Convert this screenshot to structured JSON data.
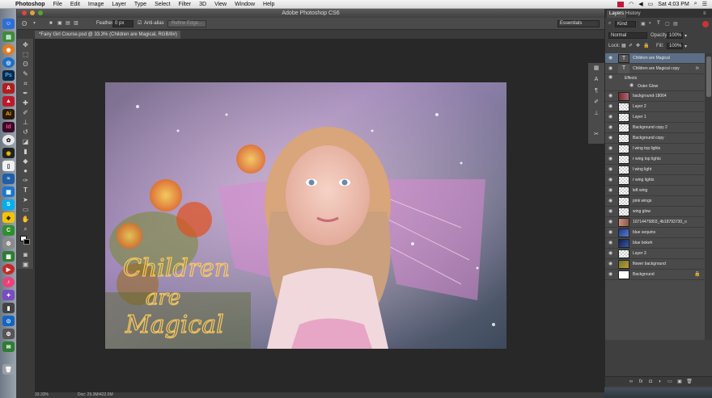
{
  "menubar": {
    "app_name": "Photoshop",
    "items": [
      "File",
      "Edit",
      "Image",
      "Layer",
      "Type",
      "Select",
      "Filter",
      "3D",
      "View",
      "Window",
      "Help"
    ],
    "clock": "Sat 4:03 PM"
  },
  "window": {
    "title": "Adobe Photoshop CS6"
  },
  "options_bar": {
    "feather_label": "Feather:",
    "feather_value": "0 px",
    "antialias_label": "Anti-alias",
    "refine_edge_label": "Refine Edge...",
    "workspace": "Essentials"
  },
  "document": {
    "tab_title": "*Fairy Girl Course.psd @ 33.3% (Children are Magical, RGB/8#)",
    "artwork_text": "Children are Magical",
    "zoom": "33.33%",
    "doc_size": "Doc: 29.3M/422.0M"
  },
  "panel": {
    "tabs": [
      "Layers",
      "History"
    ],
    "kind_label": "Kind",
    "blend_mode": "Normal",
    "opacity_label": "Opacity:",
    "opacity_value": "100%",
    "lock_label": "Lock:",
    "fill_label": "Fill:",
    "fill_value": "100%"
  },
  "layers": [
    {
      "name": "Children are Magical",
      "type": "text",
      "selected": true
    },
    {
      "name": "Children are Magical copy",
      "type": "text",
      "fx": true
    },
    {
      "name": "Effects",
      "type": "effect-group"
    },
    {
      "name": "Outer Glow",
      "type": "effect"
    },
    {
      "name": "background-18064",
      "type": "image"
    },
    {
      "name": "Layer 2",
      "type": "checker"
    },
    {
      "name": "Layer 1",
      "type": "checker"
    },
    {
      "name": "Background copy 2",
      "type": "checker"
    },
    {
      "name": "Background copy",
      "type": "checker"
    },
    {
      "name": "l wing top lights",
      "type": "checker"
    },
    {
      "name": "r wing top lights",
      "type": "checker"
    },
    {
      "name": "l wing light",
      "type": "checker"
    },
    {
      "name": "r wing lights",
      "type": "checker"
    },
    {
      "name": "left wing",
      "type": "checker"
    },
    {
      "name": "pink wings",
      "type": "checker"
    },
    {
      "name": "wing glow",
      "type": "checker"
    },
    {
      "name": "10714475803_4b18793730_o",
      "type": "image"
    },
    {
      "name": "blue sequins",
      "type": "image"
    },
    {
      "name": "blue bokeh",
      "type": "image"
    },
    {
      "name": "Layer 3",
      "type": "checker"
    },
    {
      "name": "flower background",
      "type": "image"
    },
    {
      "name": "Background",
      "type": "white",
      "locked": true
    }
  ],
  "colors": {
    "selection": "#5b6e86",
    "panel_bg": "#4a4a4a",
    "canvas_bg": "#282828"
  }
}
